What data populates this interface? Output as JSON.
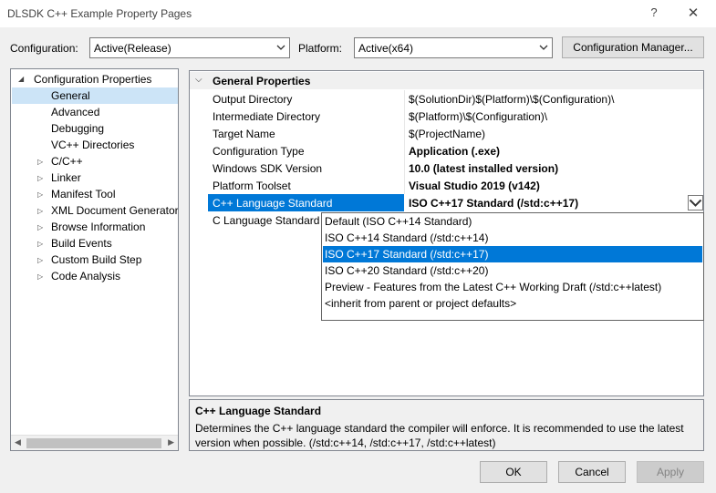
{
  "window": {
    "title": "DLSDK C++ Example Property Pages",
    "help_glyph": "?",
    "close_glyph": "✕"
  },
  "toolbar": {
    "configuration_label": "Configuration:",
    "configuration_value": "Active(Release)",
    "platform_label": "Platform:",
    "platform_value": "Active(x64)",
    "config_manager_label": "Configuration Manager..."
  },
  "tree": {
    "root": "Configuration Properties",
    "items": [
      {
        "label": "General",
        "selected": true,
        "expandable": false
      },
      {
        "label": "Advanced",
        "expandable": false
      },
      {
        "label": "Debugging",
        "expandable": false
      },
      {
        "label": "VC++ Directories",
        "expandable": false
      },
      {
        "label": "C/C++",
        "expandable": true
      },
      {
        "label": "Linker",
        "expandable": true
      },
      {
        "label": "Manifest Tool",
        "expandable": true
      },
      {
        "label": "XML Document Generator",
        "expandable": true
      },
      {
        "label": "Browse Information",
        "expandable": true
      },
      {
        "label": "Build Events",
        "expandable": true
      },
      {
        "label": "Custom Build Step",
        "expandable": true
      },
      {
        "label": "Code Analysis",
        "expandable": true
      }
    ]
  },
  "grid": {
    "category": "General Properties",
    "rows": [
      {
        "name": "Output Directory",
        "value": "$(SolutionDir)$(Platform)\\$(Configuration)\\",
        "bold": false
      },
      {
        "name": "Intermediate Directory",
        "value": "$(Platform)\\$(Configuration)\\",
        "bold": false
      },
      {
        "name": "Target Name",
        "value": "$(ProjectName)",
        "bold": false
      },
      {
        "name": "Configuration Type",
        "value": "Application (.exe)",
        "bold": true
      },
      {
        "name": "Windows SDK Version",
        "value": "10.0 (latest installed version)",
        "bold": true
      },
      {
        "name": "Platform Toolset",
        "value": "Visual Studio 2019 (v142)",
        "bold": true
      },
      {
        "name": "C++ Language Standard",
        "value": "ISO C++17 Standard (/std:c++17)",
        "bold": true
      },
      {
        "name": "C Language Standard",
        "value": "",
        "bold": false
      }
    ],
    "dropdown_options": [
      "Default (ISO C++14 Standard)",
      "ISO C++14 Standard (/std:c++14)",
      "ISO C++17 Standard (/std:c++17)",
      "ISO C++20 Standard (/std:c++20)",
      "Preview - Features from the Latest C++ Working Draft (/std:c++latest)",
      "<inherit from parent or project defaults>"
    ],
    "dropdown_selected_index": 2
  },
  "description": {
    "title": "C++ Language Standard",
    "text": "Determines the C++ language standard the compiler will enforce. It is recommended to use the latest version when possible.  (/std:c++14, /std:c++17, /std:c++latest)"
  },
  "buttons": {
    "ok": "OK",
    "cancel": "Cancel",
    "apply": "Apply"
  },
  "colors": {
    "accent": "#0078d7",
    "tree_selection": "#cce4f7"
  }
}
